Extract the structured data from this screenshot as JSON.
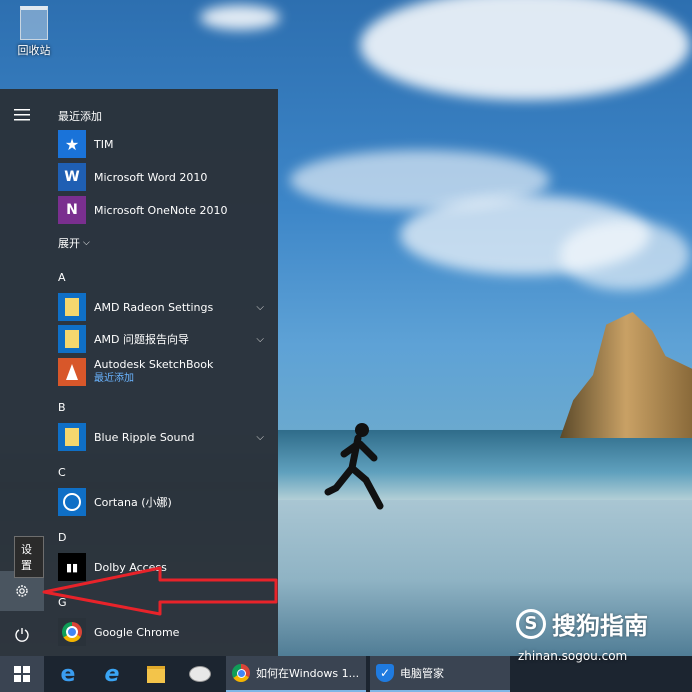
{
  "desktop": {
    "recycle_bin_label": "回收站"
  },
  "start_menu": {
    "recent_header": "最近添加",
    "recent": [
      {
        "label": "TIM",
        "tile_color": "#1a73d9",
        "icon": "star-icon"
      },
      {
        "label": "Microsoft Word 2010",
        "tile_color": "#1f5fb3",
        "icon": "word-icon"
      },
      {
        "label": "Microsoft OneNote 2010",
        "tile_color": "#7a2f8f",
        "icon": "onenote-icon"
      }
    ],
    "expand_label": "展开",
    "group_a": "A",
    "amd_settings": "AMD Radeon Settings",
    "amd_report": "AMD 问题报告向导",
    "sketchbook": "Autodesk SketchBook",
    "recently_added": "最近添加",
    "group_b": "B",
    "blue_ripple": "Blue Ripple Sound",
    "group_c": "C",
    "cortana": "Cortana (小娜)",
    "group_d": "D",
    "dolby": "Dolby Access",
    "group_g": "G",
    "chrome": "Google Chrome",
    "settings_tooltip": "设置"
  },
  "taskbar": {
    "chrome_window": "如何在Windows 1...",
    "pcmgr_window": "电脑管家"
  },
  "watermark": {
    "logo_letter": "S",
    "brand": "搜狗指南",
    "url": "zhinan.sogou.com"
  },
  "colors": {
    "accent": "#0078d7",
    "folder_tile": "#f5d76e",
    "arrow": "#e8232a"
  }
}
